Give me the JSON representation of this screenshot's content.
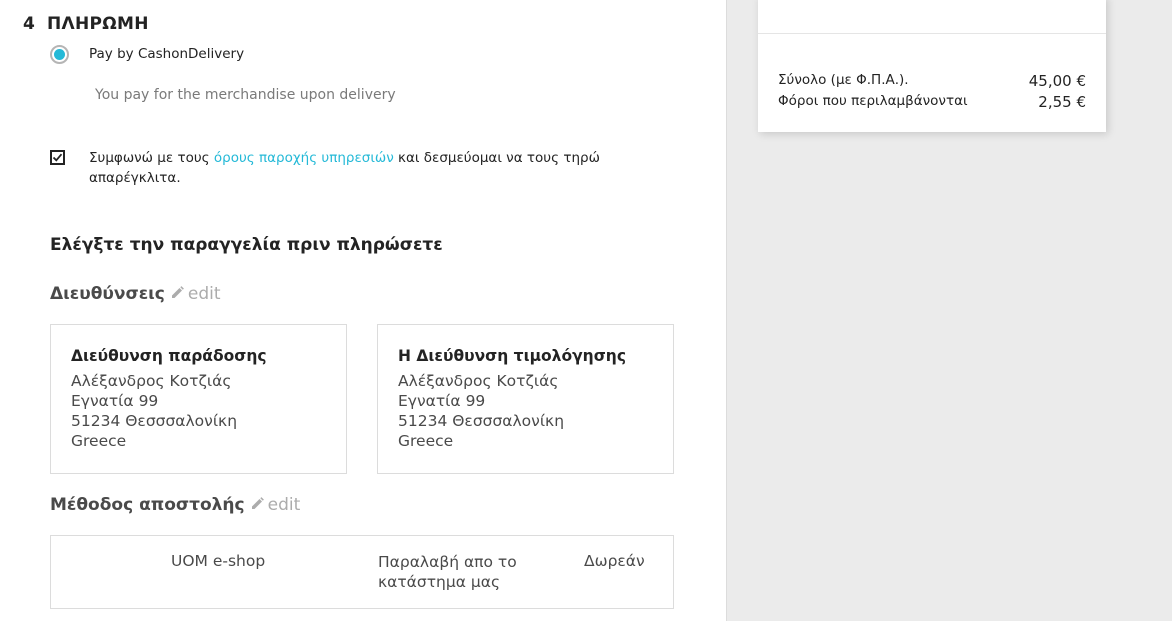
{
  "payment_step": {
    "number": "4",
    "title": "ΠΛΗΡΩΜΗ",
    "option_label": "Pay by CashonDelivery",
    "option_selected": true,
    "option_description": "You pay for the merchandise upon delivery",
    "terms_checked": true,
    "terms_before": "Συμφωνώ με τους ",
    "terms_link": "όρους παροχής υπηρεσιών",
    "terms_after": " και δεσμεύομαι να τους τηρώ απαρέγκλιτα."
  },
  "review": {
    "title": "Ελέγξτε την παραγγελία πριν πληρώσετε",
    "addresses": {
      "title": "Διευθύνσεις",
      "edit_label": "edit",
      "delivery": {
        "heading": "Διεύθυνση παράδοσης",
        "lines": [
          "Αλέξανδρος Κοτζιάς",
          "Εγνατία 99",
          "51234 Θεσσσαλονίκη",
          "Greece"
        ]
      },
      "invoice": {
        "heading": "Η Διεύθυνση τιμολόγησης",
        "lines": [
          "Αλέξανδρος Κοτζιάς",
          "Εγνατία 99",
          "51234 Θεσσσαλονίκη",
          "Greece"
        ]
      }
    },
    "shipping": {
      "title": "Μέθοδος αποστολής",
      "edit_label": "edit",
      "carrier": "UOM e-shop",
      "delay": "Παραλαβή απο το κατάστημα μας",
      "price": "Δωρεάν"
    }
  },
  "summary": {
    "total_label": "Σύνολο (με Φ.Π.Α.).",
    "total_value": "45,00 €",
    "taxes_label": "Φόροι που περιλαμβάνονται",
    "taxes_value": "2,55 €"
  },
  "colors": {
    "accent": "#24b9d7",
    "sidebar_bg": "#ebebeb"
  }
}
